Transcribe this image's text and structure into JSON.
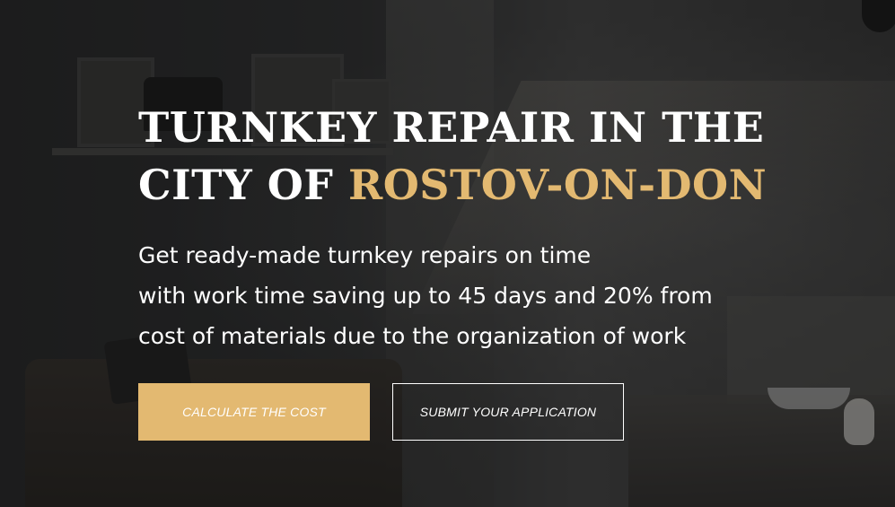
{
  "hero": {
    "headline_line1": "TURNKEY REPAIR IN THE",
    "headline_line2_prefix": "CITY OF ",
    "headline_city": "ROSTOV-ON-DON",
    "subtitle_lines": [
      "Get ready-made turnkey repairs on time",
      "with work time saving up to 45 days and 20% from",
      "cost of materials due to the organization of work"
    ],
    "accent_color": "#e3b971"
  },
  "buttons": {
    "calculate_label": "CALCULATE THE COST",
    "submit_label": "SUBMIT YOUR APPLICATION"
  }
}
